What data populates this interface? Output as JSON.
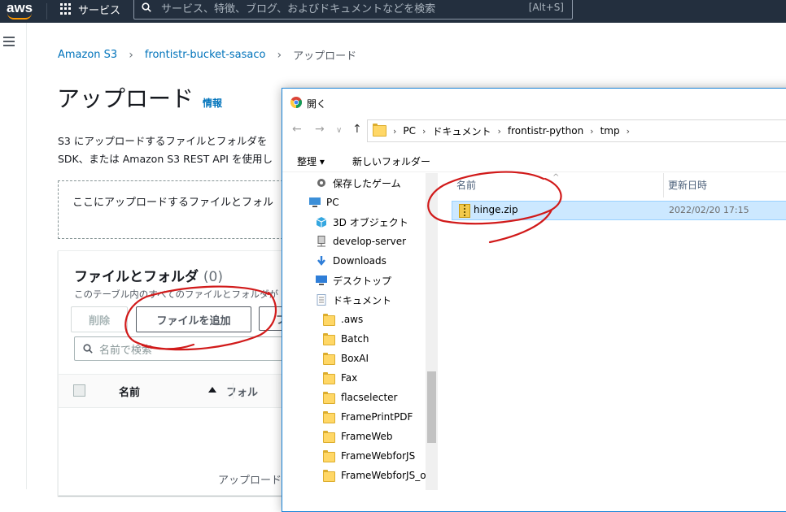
{
  "topbar": {
    "logo": "aws",
    "services": "サービス",
    "search_placeholder": "サービス、特徴、ブログ、およびドキュメントなどを検索",
    "search_shortcut": "[Alt+S]"
  },
  "breadcrumb": [
    "Amazon S3",
    "frontistr-bucket-sasaco",
    "アップロード"
  ],
  "page": {
    "title": "アップロード",
    "info": "情報",
    "desc_line1": "S3 にアップロードするファイルとフォルダを",
    "desc_line2": "SDK、または Amazon S3 REST API を使用し",
    "dropzone": "ここにアップロードするファイルとフォル"
  },
  "files_panel": {
    "heading": "ファイルとフォルダ",
    "count": "(0)",
    "subtitle": "このテーブル内のすべてのファイルとフォルダが",
    "remove": "削除",
    "add_files": "ファイルを追加",
    "add_folder_partial": "フ",
    "filter_placeholder": "名前で検索",
    "col_name": "名前",
    "col_folder": "フォル",
    "empty_text": "アップロード"
  },
  "dialog": {
    "title": "開く",
    "path": [
      "PC",
      "ドキュメント",
      "frontistr-python",
      "tmp"
    ],
    "organize": "整理 ▾",
    "new_folder": "新しいフォルダー",
    "tree": [
      {
        "label": "保存したゲーム",
        "icon": "saved-games-icon",
        "indent": 1
      },
      {
        "label": "PC",
        "icon": "pc-icon",
        "indent": 0
      },
      {
        "label": "3D オブジェクト",
        "icon": "3d-objects-icon",
        "indent": 1
      },
      {
        "label": "develop-server",
        "icon": "network-drive-icon",
        "indent": 1
      },
      {
        "label": "Downloads",
        "icon": "downloads-icon",
        "indent": 1
      },
      {
        "label": "デスクトップ",
        "icon": "desktop-icon",
        "indent": 1
      },
      {
        "label": "ドキュメント",
        "icon": "documents-icon",
        "indent": 1
      },
      {
        "label": ".aws",
        "icon": "folder-icon",
        "indent": 2
      },
      {
        "label": "Batch",
        "icon": "folder-icon",
        "indent": 2
      },
      {
        "label": "BoxAI",
        "icon": "folder-icon",
        "indent": 2
      },
      {
        "label": "Fax",
        "icon": "folder-icon",
        "indent": 2
      },
      {
        "label": "flacselecter",
        "icon": "folder-icon",
        "indent": 2
      },
      {
        "label": "FramePrintPDF",
        "icon": "folder-icon",
        "indent": 2
      },
      {
        "label": "FrameWeb",
        "icon": "folder-icon",
        "indent": 2
      },
      {
        "label": "FrameWebforJS",
        "icon": "folder-icon",
        "indent": 2
      },
      {
        "label": "FrameWebforJS_old",
        "icon": "folder-icon",
        "indent": 2
      }
    ],
    "columns": {
      "name": "名前",
      "modified": "更新日時"
    },
    "files": [
      {
        "name": "hinge.zip",
        "modified": "2022/02/20 17:15",
        "selected": true
      }
    ]
  }
}
